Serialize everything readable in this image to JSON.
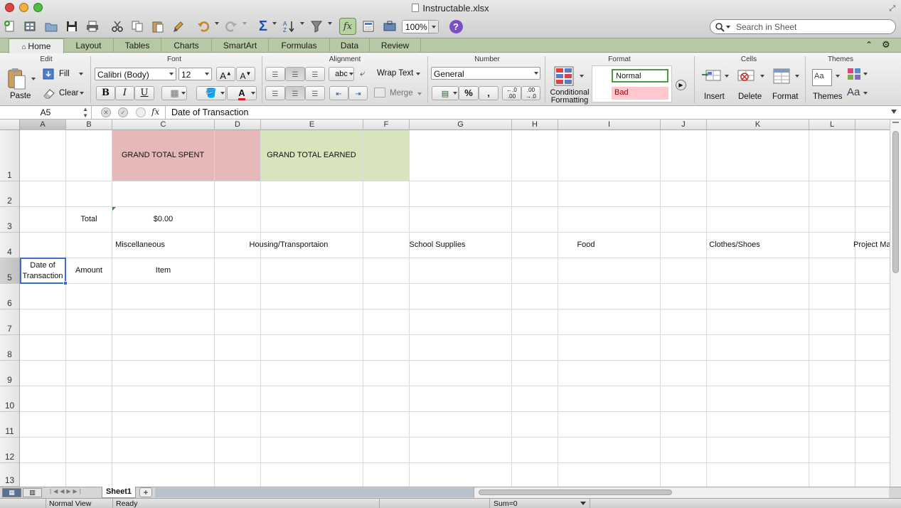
{
  "window": {
    "title": "Instructable.xlsx"
  },
  "toolbar": {
    "zoom": "100%",
    "search_placeholder": "Search in Sheet"
  },
  "ribbon": {
    "tabs": [
      {
        "label": "Home",
        "active": true
      },
      {
        "label": "Layout"
      },
      {
        "label": "Tables"
      },
      {
        "label": "Charts"
      },
      {
        "label": "SmartArt"
      },
      {
        "label": "Formulas"
      },
      {
        "label": "Data"
      },
      {
        "label": "Review"
      }
    ],
    "groups": {
      "edit": "Edit",
      "font": "Font",
      "alignment": "Alignment",
      "number": "Number",
      "format": "Format",
      "cells": "Cells",
      "themes": "Themes"
    },
    "edit": {
      "paste": "Paste",
      "fill": "Fill",
      "clear": "Clear"
    },
    "font": {
      "name": "Calibri (Body)",
      "size": "12",
      "bold": "B",
      "italic": "I",
      "underline": "U"
    },
    "alignment": {
      "wrap_text": "Wrap Text",
      "merge": "Merge",
      "abc": "abc"
    },
    "number": {
      "format": "General",
      "percent": "%",
      "comma": ","
    },
    "format": {
      "conditional_1": "Conditional",
      "conditional_2": "Formatting",
      "style_normal": "Normal",
      "style_bad": "Bad"
    },
    "cells": {
      "insert": "Insert",
      "delete": "Delete",
      "format": "Format"
    },
    "themes": {
      "themes": "Themes",
      "aa": "Aa"
    }
  },
  "formula_bar": {
    "name_box": "A5",
    "fx": "fx",
    "content": "Date of Transaction"
  },
  "sheet": {
    "columns": [
      "A",
      "B",
      "C",
      "D",
      "E",
      "F",
      "G",
      "H",
      "I",
      "J",
      "K",
      "L"
    ],
    "rows": [
      "1",
      "2",
      "3",
      "4",
      "5",
      "6",
      "7",
      "8",
      "9",
      "10",
      "11",
      "12",
      "13"
    ],
    "selected_cell": "A5",
    "cells": {
      "grand_total_spent": "GRAND TOTAL SPENT",
      "grand_total_earned": "GRAND TOTAL EARNED",
      "total_label": "Total",
      "total_value": "$0.00",
      "cat_misc": "Miscellaneous",
      "cat_housing": "Housing/Transportaion",
      "cat_school": "School Supplies",
      "cat_food": "Food",
      "cat_clothes": "Clothes/Shoes",
      "cat_project": "Project Ma",
      "hdr_date_1": "Date of",
      "hdr_date_2": "Transaction",
      "hdr_amount": "Amount",
      "hdr_item": "Item"
    },
    "colors": {
      "spent_fill": "#e6b8b7",
      "earned_fill": "#d8e4bc",
      "ribbon_tab": "#b7c9a4",
      "bad_fill": "#ffc7ce",
      "normal_border": "#4a9a3a"
    }
  },
  "sheet_tabs": {
    "active": "Sheet1",
    "add": "+"
  },
  "status": {
    "view": "Normal View",
    "state": "Ready",
    "sum": "Sum=0"
  }
}
